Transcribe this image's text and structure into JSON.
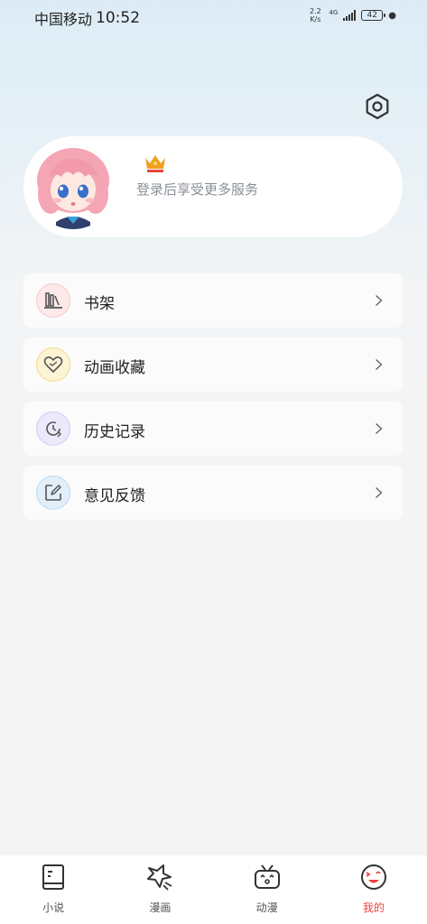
{
  "status_bar": {
    "carrier": "中国移动",
    "time": "10:52",
    "net_speed_value": "2.2",
    "net_speed_unit": "K/s",
    "network_type": "4G",
    "battery": "42"
  },
  "profile": {
    "login_hint": "登录后享受更多服务",
    "crown_color": "#f0a020"
  },
  "menu": {
    "items": [
      {
        "label": "书架",
        "icon": "bookshelf-icon",
        "color": "#e8a3a8",
        "bg": "#fde9ea"
      },
      {
        "label": "动画收藏",
        "icon": "heart-collection-icon",
        "color": "#e8c04a",
        "bg": "#fdf4d6"
      },
      {
        "label": "历史记录",
        "icon": "history-clock-icon",
        "color": "#9a86d9",
        "bg": "#ede8fa"
      },
      {
        "label": "意见反馈",
        "icon": "feedback-edit-icon",
        "color": "#6aa9e0",
        "bg": "#e2effa"
      }
    ]
  },
  "bottom_nav": {
    "tabs": [
      {
        "label": "小说",
        "icon": "novel-book-icon"
      },
      {
        "label": "漫画",
        "icon": "comic-icon"
      },
      {
        "label": "动漫",
        "icon": "anime-tv-icon"
      },
      {
        "label": "我的",
        "icon": "profile-face-icon",
        "active": true
      }
    ],
    "active_color": "#e8453c"
  }
}
